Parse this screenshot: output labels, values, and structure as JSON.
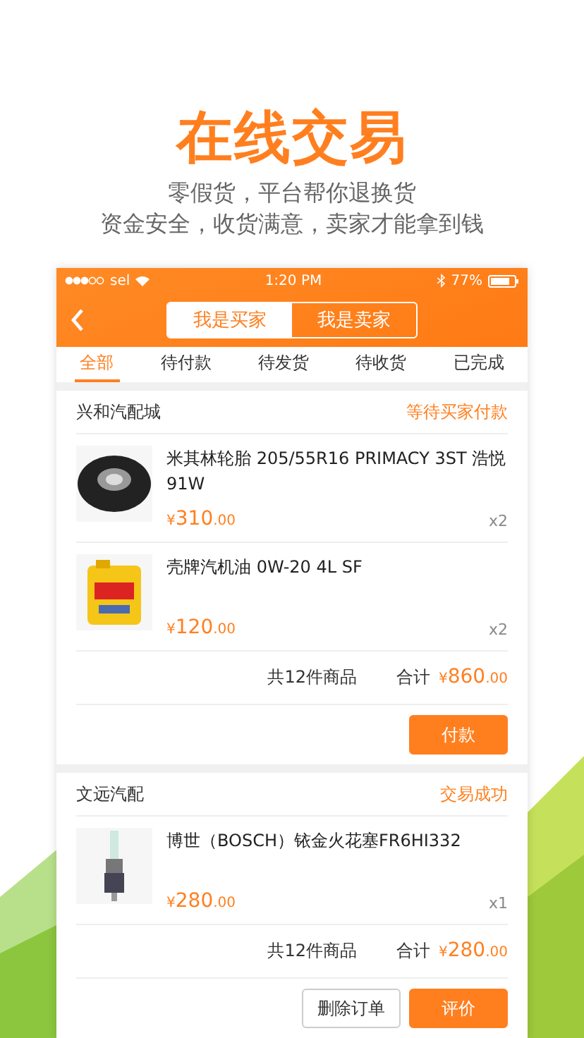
{
  "headline": "在线交易",
  "taglines": [
    "零假货，平台帮你退换货",
    "资金安全，收货满意，卖家才能拿到钱"
  ],
  "status_bar": {
    "carrier": "sel",
    "time": "1:20 PM",
    "battery": "77%"
  },
  "role_toggle": [
    {
      "label": "我是买家",
      "selected": true
    },
    {
      "label": "我是卖家",
      "selected": false
    }
  ],
  "tabs": [
    {
      "label": "全部",
      "selected": true
    },
    {
      "label": "待付款",
      "selected": false
    },
    {
      "label": "待发货",
      "selected": false
    },
    {
      "label": "待收货",
      "selected": false
    },
    {
      "label": "已完成",
      "selected": false
    }
  ],
  "orders": [
    {
      "shop": "兴和汽配城",
      "status": "等待买家付款",
      "items": [
        {
          "name": "米其林轮胎 205/55R16 PRIMACY 3ST 浩悦 91W",
          "currency": "¥",
          "amount": "310",
          "cents": ".00",
          "qty": "x2"
        },
        {
          "name": "壳牌汽机油 0W-20 4L SF",
          "currency": "¥",
          "amount": "120",
          "cents": ".00",
          "qty": "x2"
        }
      ],
      "count": "共12件商品",
      "total_label": "合计",
      "total": {
        "currency": "¥",
        "amount": "860",
        "cents": ".00"
      },
      "actions": [
        {
          "label": "付款",
          "kind": "primary"
        }
      ]
    },
    {
      "shop": "文远汽配",
      "status": "交易成功",
      "items": [
        {
          "name": "博世（BOSCH）铱金火花塞FR6HI332",
          "currency": "¥",
          "amount": "280",
          "cents": ".00",
          "qty": "x1"
        }
      ],
      "count": "共12件商品",
      "total_label": "合计",
      "total": {
        "currency": "¥",
        "amount": "280",
        "cents": ".00"
      },
      "actions": [
        {
          "label": "删除订单",
          "kind": "outline"
        },
        {
          "label": "评价",
          "kind": "primary"
        }
      ]
    }
  ]
}
